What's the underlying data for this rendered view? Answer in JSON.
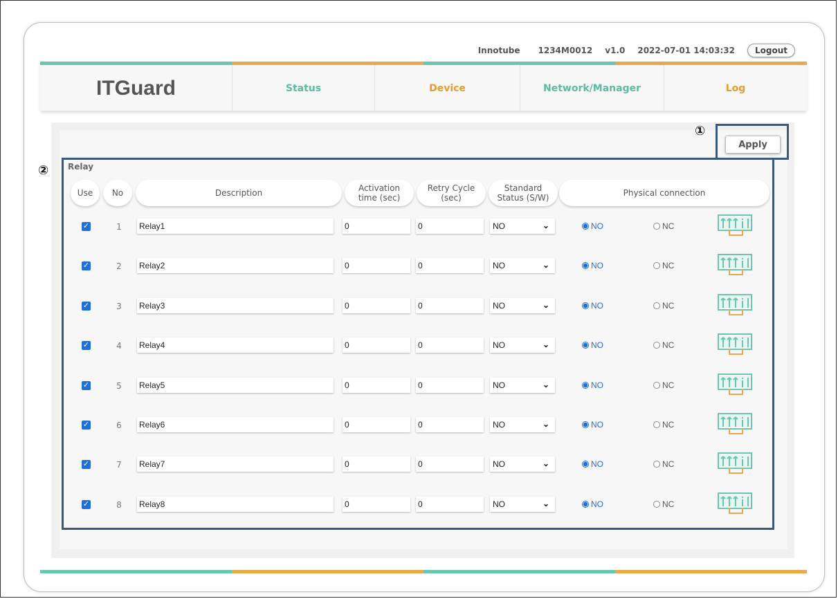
{
  "header": {
    "company": "Innotube",
    "serial": "1234M0012",
    "version": "v1.0",
    "datetime": "2022-07-01 14:03:32",
    "logout_label": "Logout"
  },
  "nav": {
    "brand": "ITGuard",
    "items": [
      {
        "label": "Status"
      },
      {
        "label": "Device"
      },
      {
        "label": "Network/Manager"
      },
      {
        "label": "Log"
      }
    ]
  },
  "colors": {
    "teal": "#6cc5b0",
    "orange": "#e9a84a",
    "callout": "#3c587f",
    "accent_blue": "#1e6fd9"
  },
  "markers": {
    "apply": "①",
    "relay": "②"
  },
  "apply_label": "Apply",
  "section": {
    "title": "Relay"
  },
  "columns": {
    "use": "Use",
    "no": "No",
    "description": "Description",
    "activation_1": "Activation",
    "activation_2": "time (sec)",
    "retry_1": "Retry Cycle",
    "retry_2": "(sec)",
    "standard_1": "Standard",
    "standard_2": "Status (S/W)",
    "physical": "Physical connection"
  },
  "relays": [
    {
      "no": "1",
      "use": true,
      "description": "Relay1",
      "activation": "0",
      "retry": "0",
      "standard": "NO",
      "phys_no": "NO",
      "phys_nc": "NC",
      "selected": "NO"
    },
    {
      "no": "2",
      "use": true,
      "description": "Relay2",
      "activation": "0",
      "retry": "0",
      "standard": "NO",
      "phys_no": "NO",
      "phys_nc": "NC",
      "selected": "NO"
    },
    {
      "no": "3",
      "use": true,
      "description": "Relay3",
      "activation": "0",
      "retry": "0",
      "standard": "NO",
      "phys_no": "NO",
      "phys_nc": "NC",
      "selected": "NO"
    },
    {
      "no": "4",
      "use": true,
      "description": "Relay4",
      "activation": "0",
      "retry": "0",
      "standard": "NO",
      "phys_no": "NO",
      "phys_nc": "NC",
      "selected": "NO"
    },
    {
      "no": "5",
      "use": true,
      "description": "Relay5",
      "activation": "0",
      "retry": "0",
      "standard": "NO",
      "phys_no": "NO",
      "phys_nc": "NC",
      "selected": "NO"
    },
    {
      "no": "6",
      "use": true,
      "description": "Relay6",
      "activation": "0",
      "retry": "0",
      "standard": "NO",
      "phys_no": "NO",
      "phys_nc": "NC",
      "selected": "NO"
    },
    {
      "no": "7",
      "use": true,
      "description": "Relay7",
      "activation": "0",
      "retry": "0",
      "standard": "NO",
      "phys_no": "NO",
      "phys_nc": "NC",
      "selected": "NO"
    },
    {
      "no": "8",
      "use": true,
      "description": "Relay8",
      "activation": "0",
      "retry": "0",
      "standard": "NO",
      "phys_no": "NO",
      "phys_nc": "NC",
      "selected": "NO"
    }
  ]
}
